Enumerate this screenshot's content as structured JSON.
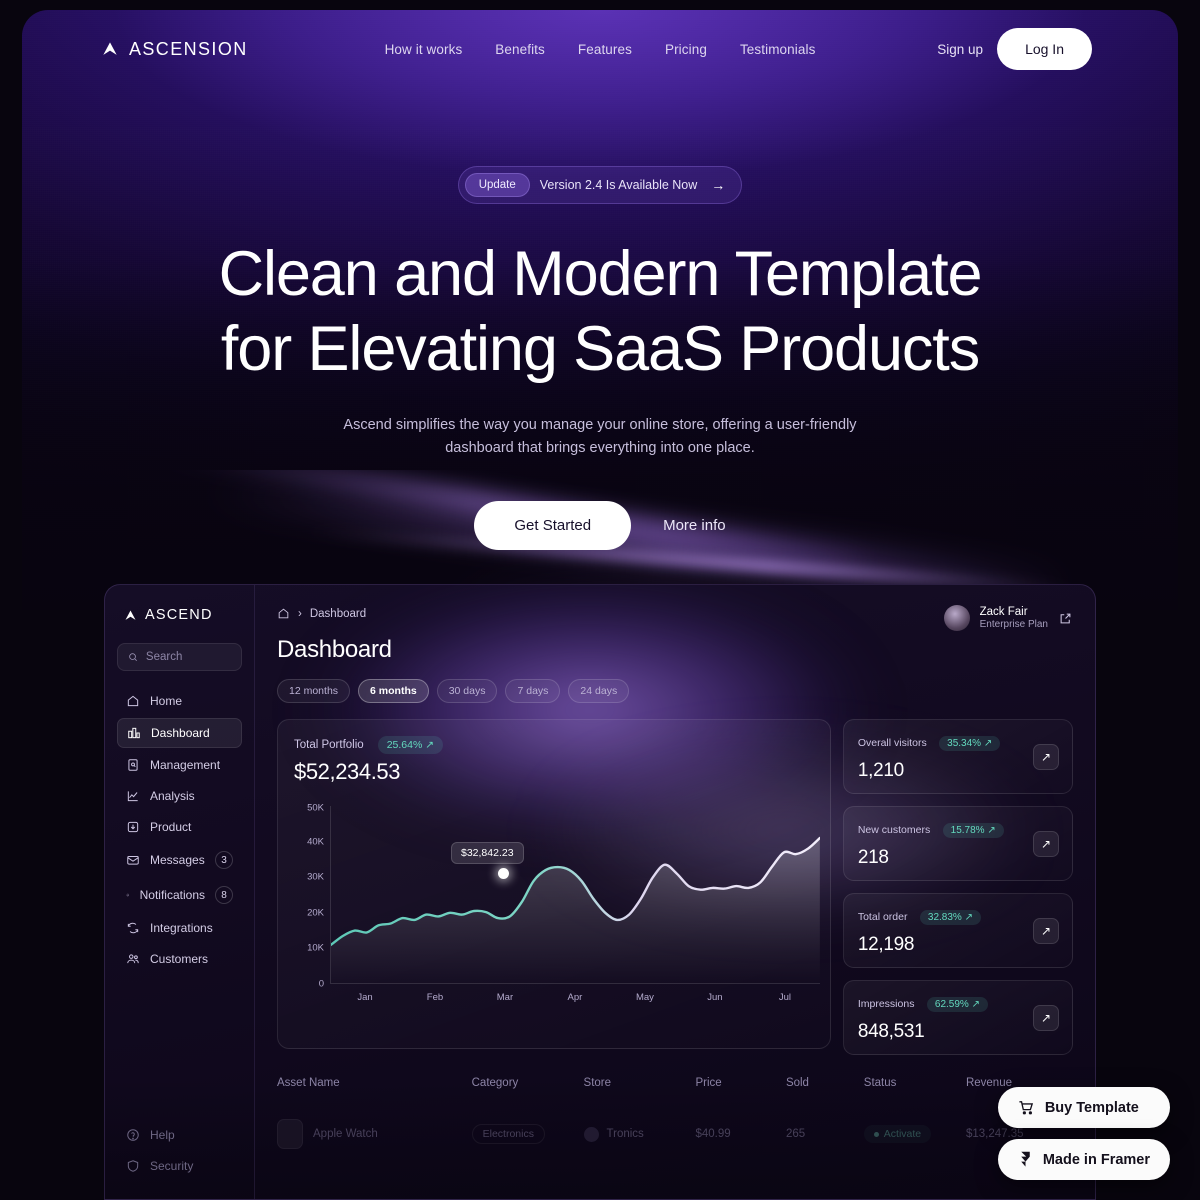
{
  "nav": {
    "brand": "ASCENSION",
    "links": [
      "How it works",
      "Benefits",
      "Features",
      "Pricing",
      "Testimonials"
    ],
    "signup": "Sign up",
    "login": "Log In"
  },
  "hero": {
    "update_tag": "Update",
    "update_text": "Version 2.4 Is Available Now",
    "title_line1": "Clean and Modern Template",
    "title_line2": "for Elevating SaaS Products",
    "sub_line1": "Ascend simplifies the way you manage your online store, offering a user-friendly",
    "sub_line2": "dashboard that brings everything into one place.",
    "cta_primary": "Get Started",
    "cta_secondary": "More info"
  },
  "dashboard": {
    "brand": "ASCEND",
    "search_placeholder": "Search",
    "sidebar": [
      {
        "label": "Home",
        "icon": "home-icon",
        "badge": ""
      },
      {
        "label": "Dashboard",
        "icon": "bar-chart-icon",
        "badge": ""
      },
      {
        "label": "Management",
        "icon": "document-icon",
        "badge": ""
      },
      {
        "label": "Analysis",
        "icon": "line-chart-icon",
        "badge": ""
      },
      {
        "label": "Product",
        "icon": "box-icon",
        "badge": ""
      },
      {
        "label": "Messages",
        "icon": "mail-icon",
        "badge": "3"
      },
      {
        "label": "Notifications",
        "icon": "bell-icon",
        "badge": "8"
      },
      {
        "label": "Integrations",
        "icon": "refresh-icon",
        "badge": ""
      },
      {
        "label": "Customers",
        "icon": "users-icon",
        "badge": ""
      }
    ],
    "sidebar_bottom": [
      {
        "label": "Help",
        "icon": "question-circle-icon"
      },
      {
        "label": "Security",
        "icon": "shield-icon"
      }
    ],
    "breadcrumb": "Dashboard",
    "page_title": "Dashboard",
    "chips": [
      "12 months",
      "6 months",
      "30 days",
      "7 days",
      "24 days"
    ],
    "active_chip": "6 months",
    "profile": {
      "name": "Zack Fair",
      "plan": "Enterprise Plan"
    },
    "portfolio": {
      "label": "Total Portfolio",
      "delta": "25.64% ↗",
      "value": "$52,234.53",
      "tooltip": "$32,842.23"
    },
    "stats": [
      {
        "title": "Overall visitors",
        "delta": "35.34% ↗",
        "value": "1,210"
      },
      {
        "title": "New customers",
        "delta": "15.78% ↗",
        "value": "218"
      },
      {
        "title": "Total order",
        "delta": "32.83% ↗",
        "value": "12,198"
      },
      {
        "title": "Impressions",
        "delta": "62.59% ↗",
        "value": "848,531"
      }
    ],
    "table": {
      "headers": [
        "Asset Name",
        "Category",
        "Store",
        "Price",
        "Sold",
        "Status",
        "Revenue"
      ],
      "rows": [
        {
          "asset": "Apple Watch",
          "category": "Electronics",
          "store": "Tronics",
          "price": "$40.99",
          "sold": "265",
          "status": "Activate",
          "revenue": "$13,247.35"
        }
      ]
    }
  },
  "floating": {
    "buy": "Buy Template",
    "framer": "Made in Framer"
  },
  "chart_data": {
    "type": "line",
    "title": "Total Portfolio",
    "xlabel": "",
    "ylabel": "",
    "x": [
      "Jan",
      "Feb",
      "Mar",
      "Apr",
      "May",
      "Jun",
      "Jul"
    ],
    "tick_labels_y": [
      "0",
      "10K",
      "20K",
      "30K",
      "40K",
      "50K"
    ],
    "ylim": [
      0,
      50000
    ],
    "grid": false,
    "highlight_point": {
      "label": "$32,842.23",
      "value": 32842.23,
      "x": "Mar"
    },
    "series": [
      {
        "name": "Portfolio",
        "color": "#5ec9b7",
        "values": [
          11000,
          13500,
          15000,
          14500,
          16500,
          17000,
          18500,
          18000,
          19500,
          19000,
          20000,
          19500,
          20500,
          20200,
          18500,
          19000,
          23000,
          29000,
          32000,
          32842,
          32000,
          29000,
          24000,
          20000,
          18000,
          19500,
          24000,
          30000,
          33500,
          31000,
          27500,
          26500,
          27000,
          26800,
          27500,
          27000,
          28500,
          33000,
          37000,
          36500,
          38000,
          41000
        ]
      }
    ]
  }
}
